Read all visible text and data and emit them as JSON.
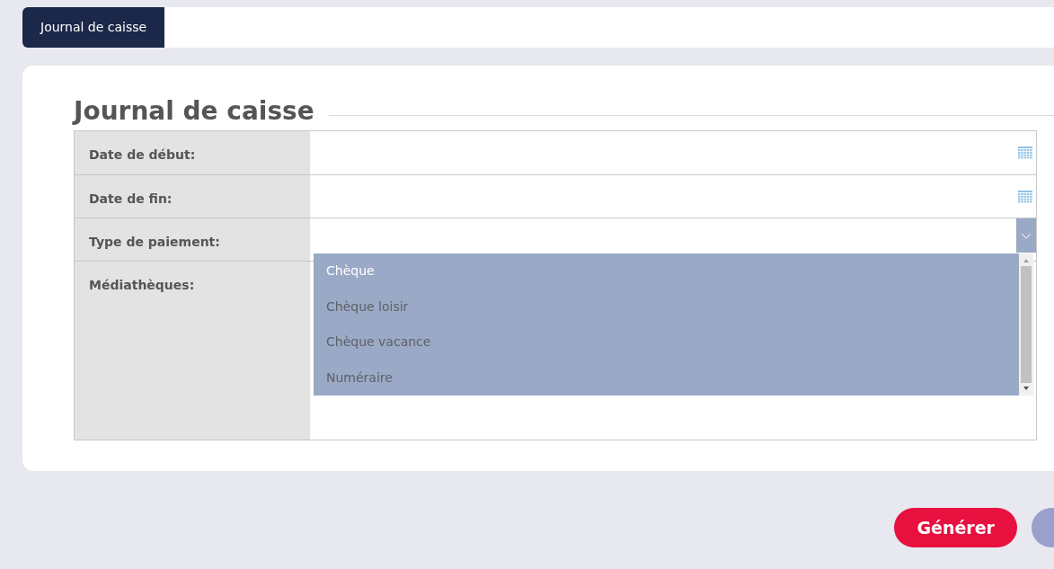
{
  "tabs": [
    {
      "label": "Journal de caisse",
      "selected": true
    }
  ],
  "form": {
    "title": "Journal de caisse",
    "fields": [
      {
        "kind": "date",
        "label": "Date de début:"
      },
      {
        "kind": "date",
        "label": "Date de fin:"
      },
      {
        "kind": "select",
        "label": "Type de paiement:",
        "expanded": true,
        "options": [
          {
            "label": "Chèque",
            "selected": true
          },
          {
            "label": "Chèque loisir",
            "selected": false
          },
          {
            "label": "Chèque vacance",
            "selected": false
          },
          {
            "label": "Numéraire",
            "selected": false
          }
        ]
      },
      {
        "kind": "list",
        "label": "Médiathèques:"
      }
    ]
  },
  "actions": [
    {
      "label": "Générer"
    }
  ]
}
